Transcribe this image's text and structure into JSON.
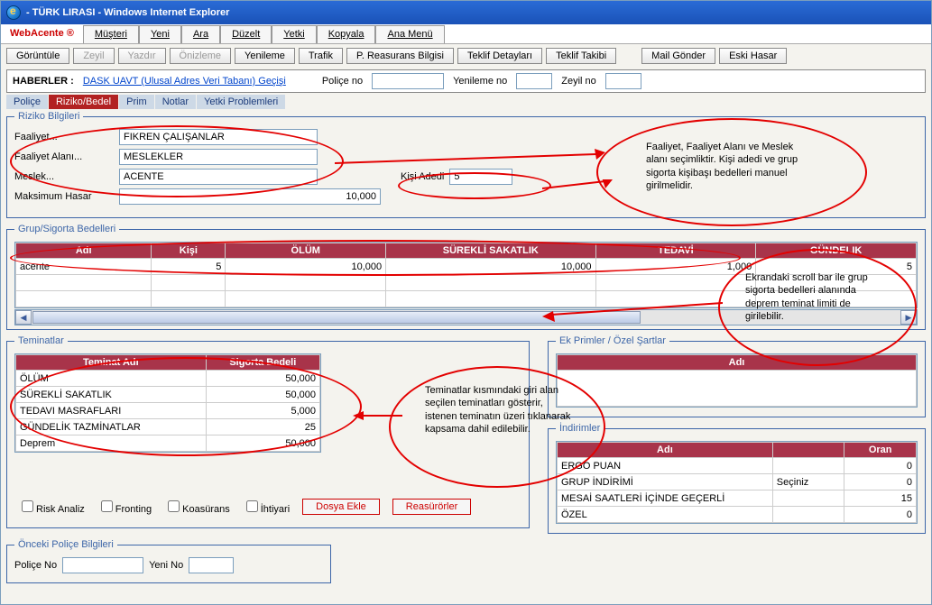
{
  "window": {
    "title": "- TÜRK LIRASI - Windows Internet Explorer"
  },
  "app": {
    "name": "WebAcente ®",
    "menu": [
      "Müşteri",
      "Yeni",
      "Ara",
      "Düzelt",
      "Yetki",
      "Kopyala",
      "Ana Menü"
    ]
  },
  "toolbar": {
    "buttons": [
      "Görüntüle",
      "Zeyil",
      "Yazdır",
      "Önizleme",
      "Yenileme",
      "Trafik",
      "P. Reasurans Bilgisi",
      "Teklif Detayları",
      "Teklif Takibi",
      "Mail Gönder",
      "Eski Hasar"
    ]
  },
  "haberler": {
    "label": "HABERLER :",
    "link": "DASK UAVT (Ulusal Adres Veri Tabanı) Geçişi",
    "police_label": "Poliçe no",
    "police_val": "",
    "yenileme_label": "Yenileme no",
    "yenileme_val": "",
    "zeyil_label": "Zeyil no",
    "zeyil_val": ""
  },
  "tabs": [
    "Poliçe",
    "Riziko/Bedel",
    "Prim",
    "Notlar",
    "Yetki Problemleri"
  ],
  "active_tab": 1,
  "riziko": {
    "legend": "Riziko Bilgileri",
    "faaliyet_label": "Faaliyet...",
    "faaliyet": "FIKREN ÇALIŞANLAR",
    "faaliyet_alani_label": "Faaliyet Alanı...",
    "faaliyet_alani": "MESLEKLER",
    "meslek_label": "Meslek...",
    "meslek": "ACENTE",
    "kisi_adedi_label": "Kişi Adedi",
    "kisi_adedi": "5",
    "maks_hasar_label": "Maksimum Hasar",
    "maks_hasar": "10,000"
  },
  "grup": {
    "legend": "Grup/Sigorta Bedelleri",
    "headers": [
      "Adı",
      "Kişi",
      "ÖLÜM",
      "SÜREKLİ SAKATLIK",
      "TEDAVİ",
      "GÜNDELIK"
    ],
    "rows": [
      {
        "adi": "acente",
        "kisi": "5",
        "olum": "10,000",
        "surekli": "10,000",
        "tedavi": "1,000",
        "gundelik": "5"
      }
    ]
  },
  "teminatlar": {
    "legend": "Teminatlar",
    "headers": [
      "Teminat Adı",
      "Sigorta Bedeli"
    ],
    "rows": [
      [
        "ÖLÜM",
        "50,000"
      ],
      [
        "SÜREKLİ SAKATLIK",
        "50,000"
      ],
      [
        "TEDAVI MASRAFLARI",
        "5,000"
      ],
      [
        "GÜNDELİK TAZMİNATLAR",
        "25"
      ],
      [
        "Deprem",
        "50,000"
      ]
    ]
  },
  "ekprimler": {
    "legend": "Ek Primler / Özel Şartlar",
    "header": "Adı"
  },
  "indirimler": {
    "legend": "İndirimler",
    "headers": [
      "Adı",
      "",
      "Oran"
    ],
    "rows": [
      [
        "ERGO PUAN",
        "",
        "0"
      ],
      [
        "GRUP İNDİRİMİ",
        "Seçiniz",
        "0"
      ],
      [
        "MESAİ SAATLERİ İÇİNDE GEÇERLİ",
        "",
        "15"
      ],
      [
        "ÖZEL",
        "",
        "0"
      ]
    ]
  },
  "checks": {
    "risk": "Risk Analiz",
    "fronting": "Fronting",
    "koasurans": "Koasürans",
    "ihtiyari": "İhtiyari",
    "dosya": "Dosya Ekle",
    "reasurorler": "Reasürörler"
  },
  "onceki": {
    "legend": "Önceki Poliçe Bilgileri",
    "police_label": "Poliçe No",
    "police_val": "",
    "yeni_label": "Yeni No",
    "yeni_val": ""
  },
  "annotations": {
    "a1": "Faaliyet, Faaliyet Alanı ve Meslek alanı seçimliktir. Kişi adedi ve grup sigorta kişibaşı bedelleri manuel girilmelidir.",
    "a2": "Ekrandaki scroll bar ile grup sigorta bedelleri alanında deprem teminat limiti de girilebilir.",
    "a3": "Teminatlar kısmındaki giri alan seçilen teminatları gösterir, istenen teminatın üzeri tıklanarak kapsama dahil edilebilir."
  }
}
